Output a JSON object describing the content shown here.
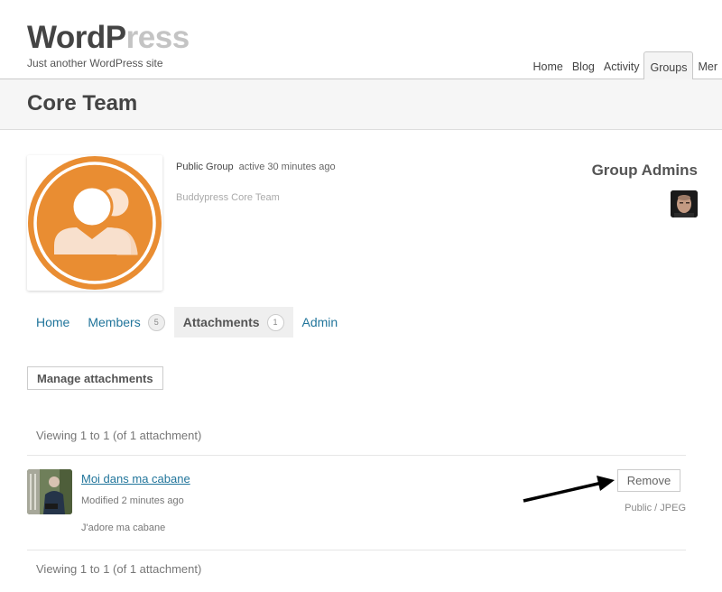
{
  "site": {
    "title_dark": "WordP",
    "title_light": "ress",
    "description": "Just another WordPress site"
  },
  "nav": {
    "items": [
      {
        "label": "Home",
        "active": false
      },
      {
        "label": "Blog",
        "active": false
      },
      {
        "label": "Activity",
        "active": false
      },
      {
        "label": "Groups",
        "active": true
      },
      {
        "label": "Mer",
        "active": false
      }
    ]
  },
  "page": {
    "title": "Core Team"
  },
  "group": {
    "avatar_icon": "group-avatar-icon",
    "avatar_color": "#e98d32",
    "type": "Public Group",
    "active": "active 30 minutes ago",
    "description": "Buddypress Core Team"
  },
  "admins": {
    "title": "Group Admins",
    "avatars": [
      "admin-avatar"
    ]
  },
  "subnav": {
    "items": [
      {
        "label": "Home",
        "count": null,
        "current": false
      },
      {
        "label": "Members",
        "count": "5",
        "current": false
      },
      {
        "label": "Attachments",
        "count": "1",
        "current": true
      },
      {
        "label": "Admin",
        "count": null,
        "current": false
      }
    ]
  },
  "actions": {
    "manage_label": "Manage attachments"
  },
  "pagination": {
    "top": "Viewing 1 to 1 (of 1 attachment)",
    "bottom": "Viewing 1 to 1 (of 1 attachment)"
  },
  "attachments": [
    {
      "title": "Moi dans ma cabane",
      "modified": "Modified 2 minutes ago",
      "description": "J'adore ma cabane",
      "remove_label": "Remove",
      "type": "Public / JPEG"
    }
  ],
  "colors": {
    "link": "#21759b",
    "accent": "#e98d32"
  }
}
